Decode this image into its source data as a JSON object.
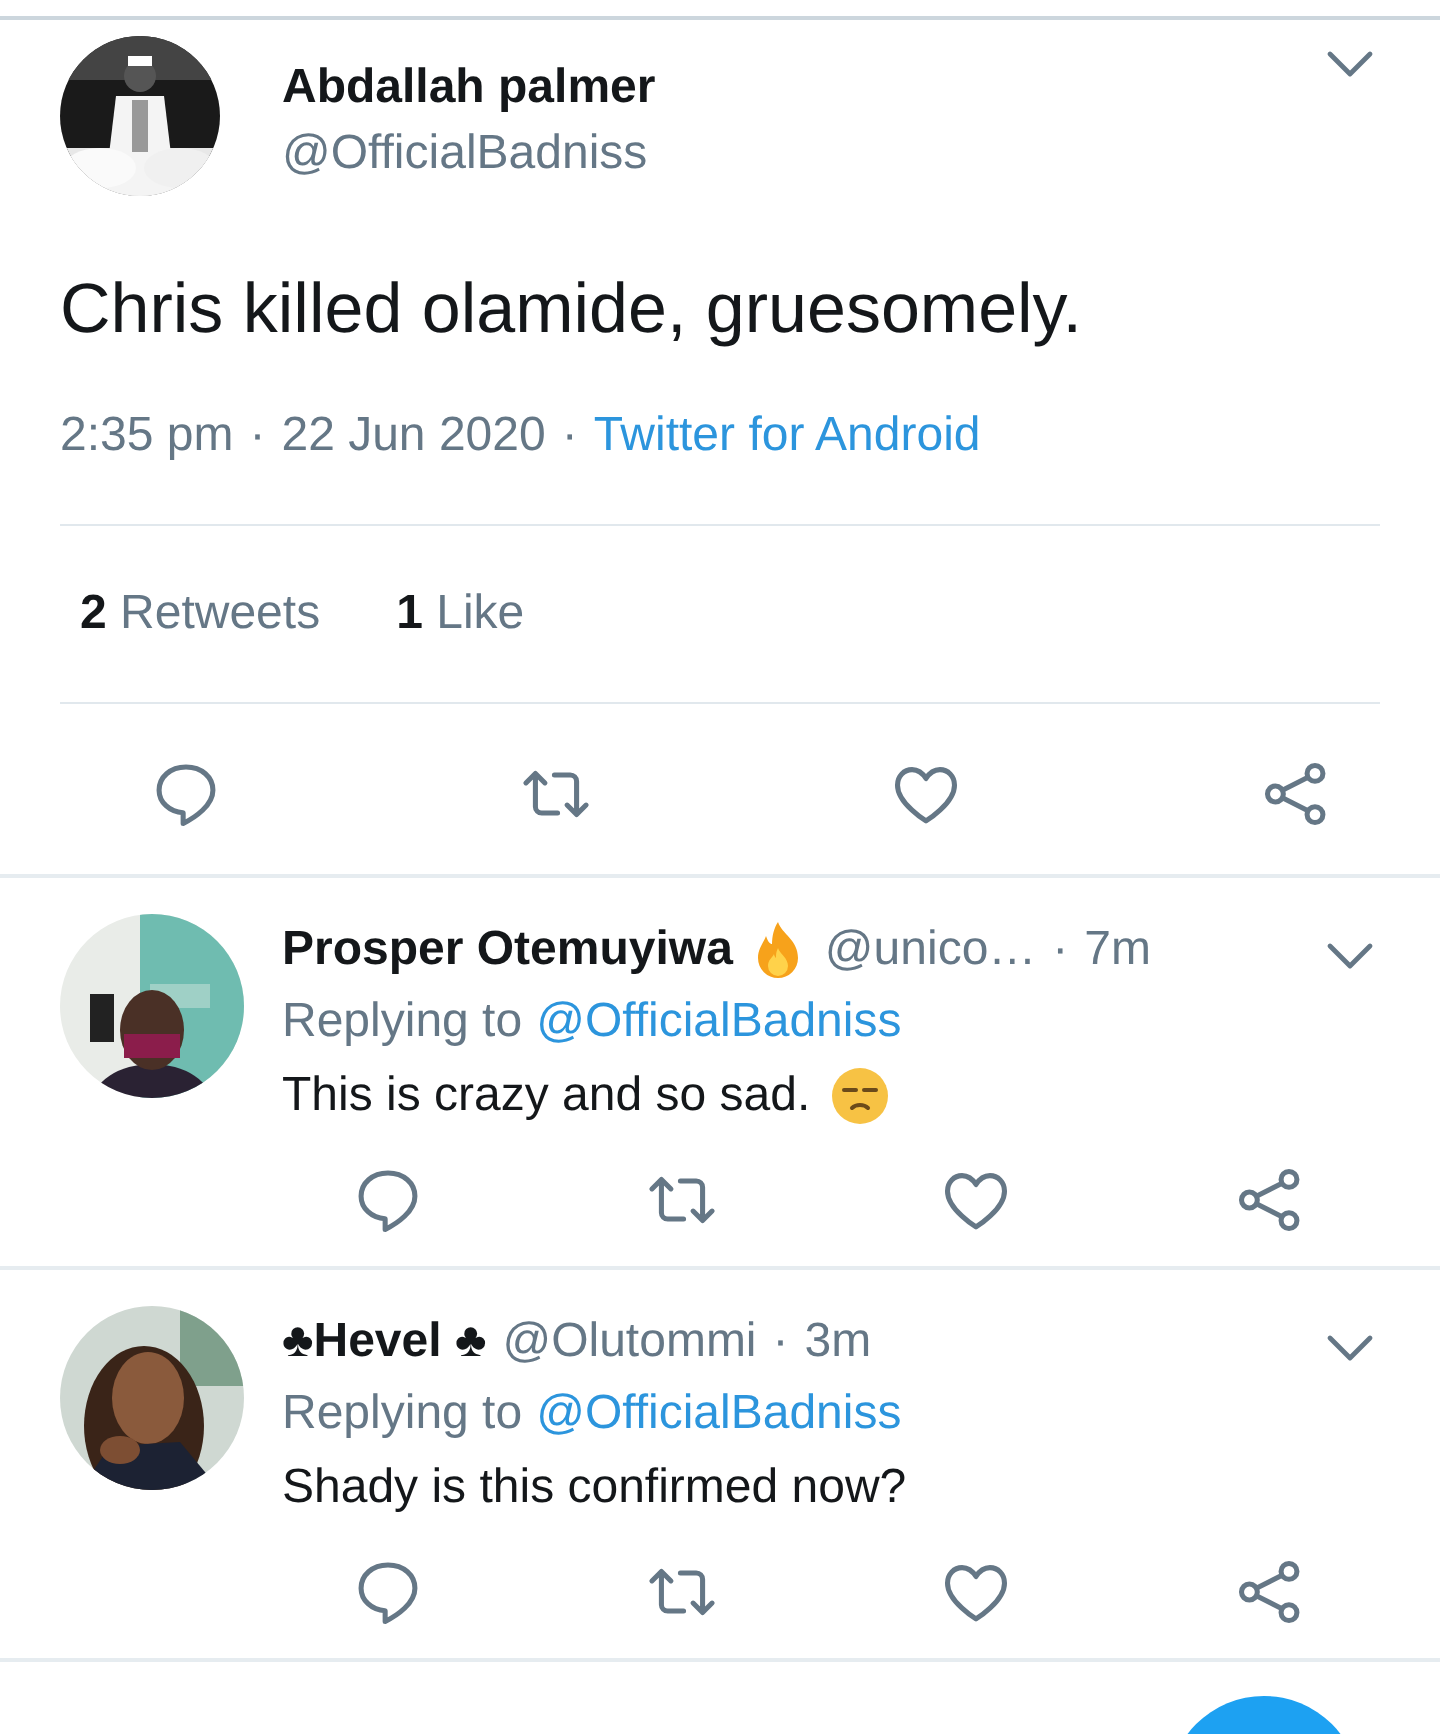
{
  "tweet": {
    "author": {
      "name": "Abdallah palmer",
      "handle": "@OfficialBadniss"
    },
    "text": "Chris killed olamide, gruesomely.",
    "time": "2:35 pm",
    "separator": "·",
    "date": "22 Jun 2020",
    "source": "Twitter for Android",
    "stats": [
      {
        "count": "2",
        "label": "Retweets"
      },
      {
        "count": "1",
        "label": "Like"
      }
    ]
  },
  "replies": [
    {
      "name": "Prosper Otemuyiwa",
      "fire_badge": true,
      "handle": "@unico…",
      "separator": "·",
      "age": "7m",
      "replying_label": "Replying to",
      "replying_to": "@OfficialBadniss",
      "text": "This is crazy and so sad.",
      "face_emoji": true
    },
    {
      "name": "♣Hevel ♣",
      "fire_badge": false,
      "handle": "@Olutommi",
      "separator": "·",
      "age": "3m",
      "replying_label": "Replying to",
      "replying_to": "@OfficialBadniss",
      "text": "Shady is this confirmed now?",
      "face_emoji": false
    }
  ]
}
